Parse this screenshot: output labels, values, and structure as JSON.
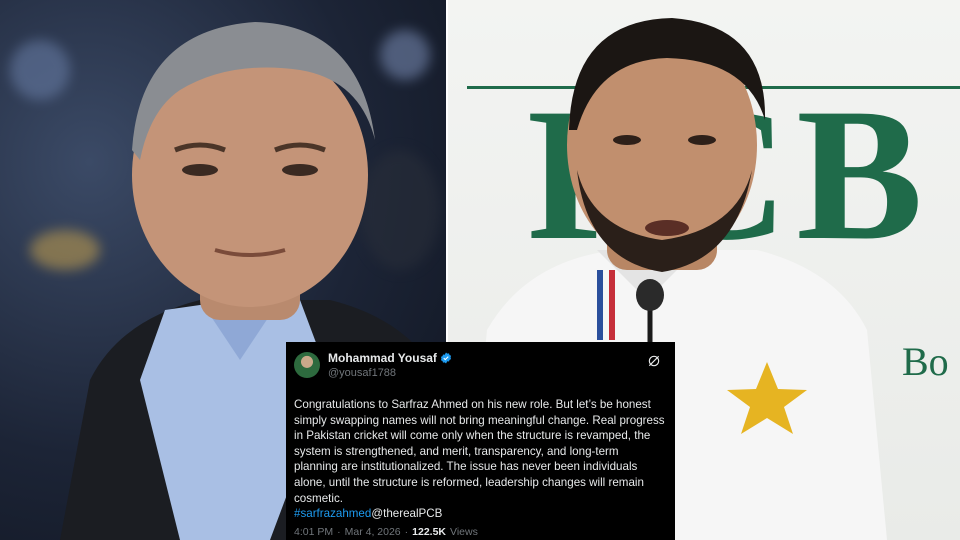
{
  "tweet": {
    "display_name": "Mohammad Yousaf",
    "handle": "@yousaf1788",
    "body": "Congratulations to Sarfraz Ahmed on his new role. But let’s be honest simply swapping names will not bring meaningful change. Real progress in Pakistan cricket will come only when the structure is revamped, the system is strengthened, and merit, transparency, and long-term planning are institutionalized. The issue has never been individuals alone, until the structure is reformed, leadership changes will remain cosmetic.",
    "hashtag": "#sarfrazahmed",
    "mention": "@therealPCB",
    "time": "4:01 PM",
    "separator": "·",
    "date": "Mar 4, 2026",
    "views_count": "122.5K",
    "views_label": "Views"
  },
  "backdrop": {
    "pcb_letters": "PCB",
    "board_text": "Bo"
  },
  "colors": {
    "tweet_bg": "#000000",
    "link_blue": "#1d9bf0",
    "verified_blue": "#1d9bf0",
    "pcb_green": "#1f6b4a"
  },
  "icons": {
    "verified": "verified-badge-icon",
    "grok": "grok-icon",
    "avatar": "avatar"
  }
}
